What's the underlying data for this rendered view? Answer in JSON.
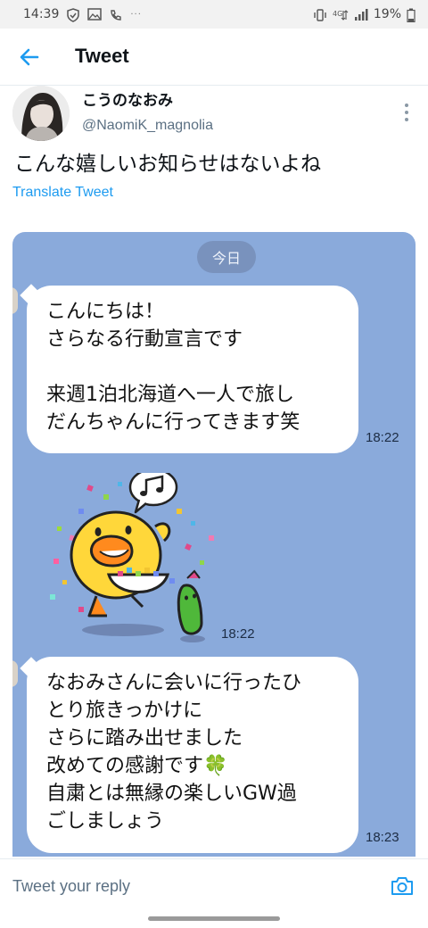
{
  "status_bar": {
    "time": "14:39",
    "battery": "19%",
    "overflow": "···",
    "network": "4G"
  },
  "header": {
    "title": "Tweet"
  },
  "tweet": {
    "display_name": "こうのなおみ",
    "handle": "@NaomiK_magnolia",
    "text": "こんな嬉しいお知らせはないよね",
    "translate_label": "Translate Tweet"
  },
  "media": {
    "date_pill": "今日",
    "messages": [
      {
        "text": "こんにちは！\nさらなる行動宣言です\n\n来週1泊北海道へ一人で旅し\nだんちゃんに行ってきます笑",
        "time": "18:22"
      },
      {
        "type": "sticker",
        "time": "18:22"
      },
      {
        "text": "なおみさんに会いに行ったひ\nとり旅きっかけに\nさらに踏み出せました\n改めての感謝です🍀\n自粛とは無縁の楽しいGW過\nごしましょう",
        "time": "18:23"
      }
    ]
  },
  "reply": {
    "placeholder": "Tweet your reply"
  },
  "colors": {
    "accent": "#1d9bf0",
    "chat_background": "#8aaadb",
    "pill": "#7992bd"
  },
  "icons": [
    "back-arrow-icon",
    "more-vertical-icon",
    "camera-icon",
    "clover-icon"
  ]
}
